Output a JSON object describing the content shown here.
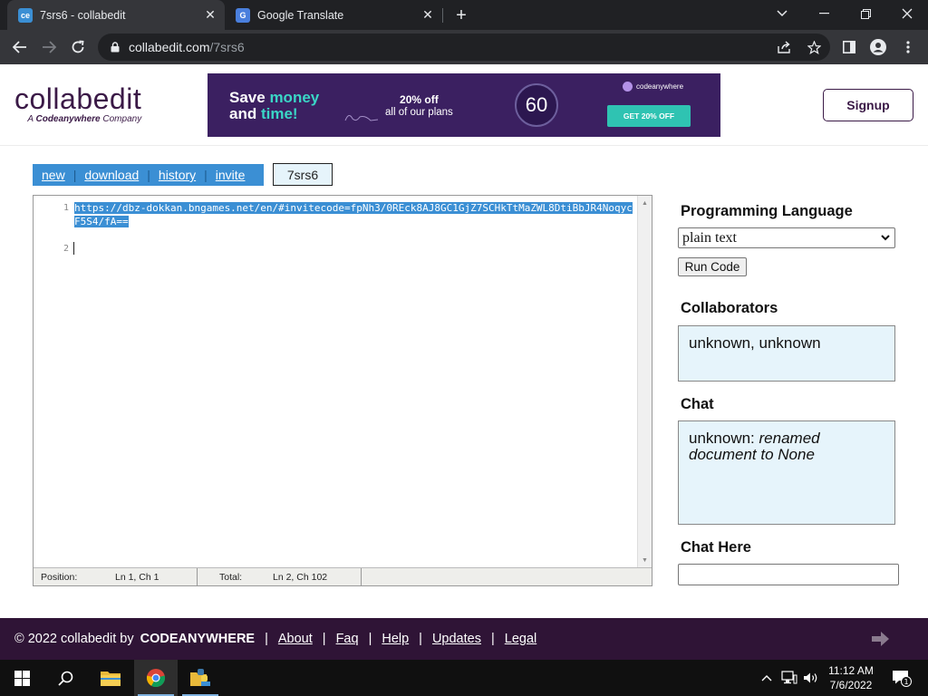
{
  "browser": {
    "tabs": [
      {
        "title": "7srs6 - collabedit",
        "favicon": "ce",
        "active": true
      },
      {
        "title": "Google Translate",
        "favicon": "G",
        "active": false
      }
    ],
    "url_domain": "collabedit.com",
    "url_path": "/7srs6"
  },
  "header": {
    "logo_text": "collabedit",
    "logo_sub_prefix": "A ",
    "logo_sub_brand": "Codeanywhere",
    "logo_sub_suffix": " Company",
    "signup_label": "Signup"
  },
  "ad": {
    "headline_1a": "Save ",
    "headline_1b": "money",
    "headline_2a": "and ",
    "headline_2b": "time!",
    "offer_top": "20% off",
    "offer_bottom": "all of our plans",
    "timer": "60",
    "brand": "codeanywhere",
    "cta": "GET 20% OFF"
  },
  "doc_toolbar": {
    "links": [
      "new",
      "download",
      "history",
      "invite"
    ],
    "separator": "|",
    "doc_id": "7srs6"
  },
  "editor": {
    "line_numbers": [
      "1",
      "2"
    ],
    "line1": "https://dbz-dokkan.bngames.net/en/#invitecode=fpNh3/0REck8AJ8GC1GjZ7SCHkTtMaZWL8DtiBbJR4NoqycF5S4/fA==",
    "status": {
      "position_label": "Position:",
      "position_value": "Ln 1, Ch 1",
      "total_label": "Total:",
      "total_value": "Ln 2, Ch 102"
    }
  },
  "sidebar": {
    "lang_title": "Programming Language",
    "lang_selected": "plain text",
    "run_label": "Run Code",
    "collab_title": "Collaborators",
    "collab_text": "unknown, unknown",
    "chat_title": "Chat",
    "chat_user": "unknown:",
    "chat_msg": "renamed document to None",
    "chat_here_title": "Chat Here"
  },
  "footer": {
    "copyright": "© 2022 collabedit by",
    "brand": "CODEANYWHERE",
    "links": [
      "About",
      "Faq",
      "Help",
      "Updates",
      "Legal"
    ]
  },
  "taskbar": {
    "time": "11:12 AM",
    "date": "7/6/2022",
    "notification_count": "1"
  }
}
